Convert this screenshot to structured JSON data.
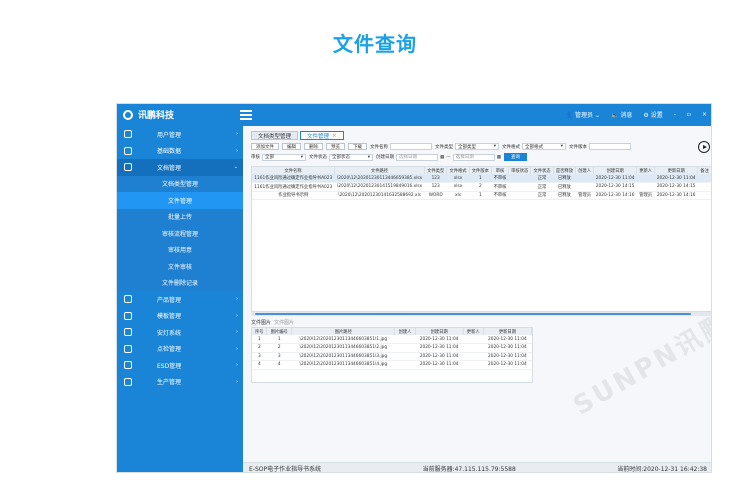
{
  "page_title": "文件查询",
  "app": {
    "brand": "讯鹏科技",
    "topbar": {
      "admin": "管理员",
      "messages": "消息",
      "settings": "设置",
      "minimize": "-",
      "maximize": "▫",
      "close": "×"
    }
  },
  "sidebar": {
    "items": [
      {
        "label": "用户管理",
        "icon": "users-icon"
      },
      {
        "label": "基础数据",
        "icon": "monitor-icon"
      },
      {
        "label": "文档管理",
        "icon": "folder-icon",
        "active": true
      },
      {
        "label": "产品管理",
        "icon": "box-icon"
      },
      {
        "label": "模板管理",
        "icon": "template-icon"
      },
      {
        "label": "安灯系统",
        "icon": "bell-icon"
      },
      {
        "label": "点检管理",
        "icon": "checklist-icon"
      },
      {
        "label": "ESD管理",
        "icon": "esd-icon"
      },
      {
        "label": "生产管理",
        "icon": "layers-icon"
      }
    ],
    "doc_subitems": [
      "文档类型管理",
      "文件管理",
      "批量上传",
      "审核流程管理",
      "审核用意",
      "文件审核",
      "文件删除记录"
    ]
  },
  "tabs": [
    {
      "label": "文档类型管理"
    },
    {
      "label": "文件管理",
      "active": true
    }
  ],
  "toolbar": {
    "buttons": [
      "添加文件",
      "编辑",
      "删除",
      "预览",
      "下载"
    ],
    "file_name_label": "文件名称",
    "file_type_label": "文件类型",
    "file_type_value": "全部类型",
    "file_format_label": "文件格式",
    "file_format_value": "全部格式",
    "file_version_label": "文件版本",
    "audit_label": "审核",
    "audit_value": "全部",
    "file_status_label": "文件状态",
    "file_status_value": "全部状态",
    "created_label": "创建日期",
    "date_placeholder": "选择日期",
    "range_sep": "—",
    "query": "查询"
  },
  "table1": {
    "headers": [
      "文件名称",
      "文件路径",
      "文件类型",
      "文件格式",
      "文件版本",
      "审核",
      "审核状态",
      "文件状态",
      "是否释放",
      "创建人",
      "创建日期",
      "更新人",
      "更新日期",
      "备注"
    ],
    "rows": [
      [
        "1161作业风险通过确定作业指导书A023",
        "\\2020\\12\\20201230113446659385.xlsx",
        "123",
        "xlsx",
        "1",
        "不审核",
        "",
        "正常",
        "已释放",
        "",
        "2020-12-30 11:04",
        "",
        "2020-12-30 11:04",
        ""
      ],
      [
        "1161作业风险通过确定作业指导书A023",
        "\\2020\\12\\20201230141519849016.xlsx",
        "123",
        "xlsx",
        "2",
        "不审核",
        "",
        "正常",
        "已释放",
        "",
        "2020-12-30 14:15",
        "",
        "2020-12-30 14:15",
        ""
      ],
      [
        "作业指导书示例",
        "\\2020\\12\\20201230141632588692.xls",
        "WORD",
        "xls",
        "1",
        "不审核",
        "",
        "正常",
        "已释放",
        "管理员",
        "2020-12-30 14:16",
        "管理员",
        "2020-12-30 14:16",
        ""
      ]
    ]
  },
  "table2": {
    "title": "文件图片",
    "title_muted": "文件图片",
    "headers": [
      "序号",
      "图片编号",
      "图片路径",
      "创建人",
      "创建日期",
      "更新人",
      "更新日期"
    ],
    "rows": [
      [
        "1",
        "1",
        "\\2020\\12\\20201230113446603851\\1.jpg",
        "",
        "2020-12-30 11:04",
        "",
        "2020-12-30 11:04"
      ],
      [
        "2",
        "2",
        "\\2020\\12\\20201230113446603851\\2.jpg",
        "",
        "2020-12-30 11:04",
        "",
        "2020-12-30 11:04"
      ],
      [
        "3",
        "3",
        "\\2020\\12\\20201230113446603851\\3.jpg",
        "",
        "2020-12-30 11:04",
        "",
        "2020-12-30 11:04"
      ],
      [
        "4",
        "4",
        "\\2020\\12\\20201230113446603851\\4.jpg",
        "",
        "2020-12-30 11:04",
        "",
        "2020-12-30 11:04"
      ]
    ]
  },
  "status": {
    "system": "E-SOP电子作业指导书系统",
    "server": "当前服务器:47.115.115.79:5588",
    "time": "当前时间:2020-12-31 16:42:38"
  },
  "watermark": "SUNPN讯鹏"
}
